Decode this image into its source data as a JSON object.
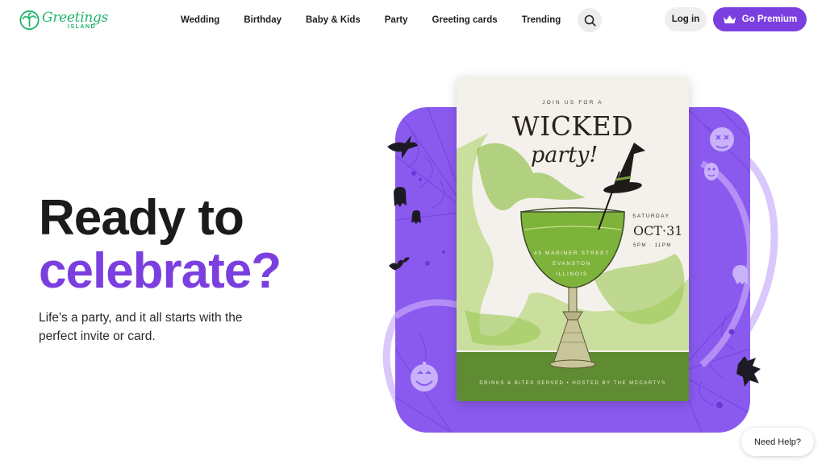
{
  "brand": {
    "logo_word": "Greetings",
    "logo_sub": "ISLAND"
  },
  "nav": {
    "items": [
      {
        "label": "Wedding"
      },
      {
        "label": "Birthday"
      },
      {
        "label": "Baby & Kids"
      },
      {
        "label": "Party"
      },
      {
        "label": "Greeting cards"
      },
      {
        "label": "Trending"
      }
    ],
    "search_icon": "search-icon"
  },
  "actions": {
    "login_label": "Log in",
    "premium_label": "Go Premium",
    "premium_icon": "crown-icon"
  },
  "hero": {
    "title_line1": "Ready to",
    "title_line2": "celebrate?",
    "subtitle": "Life's a party, and it all starts with the perfect invite or card."
  },
  "invitation": {
    "kicker": "JOIN US FOR A",
    "title": "WICKED",
    "script": "party!",
    "day": "SATURDAY",
    "date": "OCT·31",
    "time": "5PM · 11PM",
    "address_line1": "45 MARINER STREET",
    "address_line2": "EVANSTON",
    "address_line3": "ILLINOIS",
    "footer": "DRINKS & BITES SERVED • HOSTED BY THE MCCARTYS"
  },
  "help": {
    "label": "Need Help?"
  },
  "colors": {
    "brand_green": "#1fb36b",
    "accent_purple": "#7b3fe0",
    "panel_purple": "#8a5aef",
    "drink_green": "#86b83c"
  }
}
